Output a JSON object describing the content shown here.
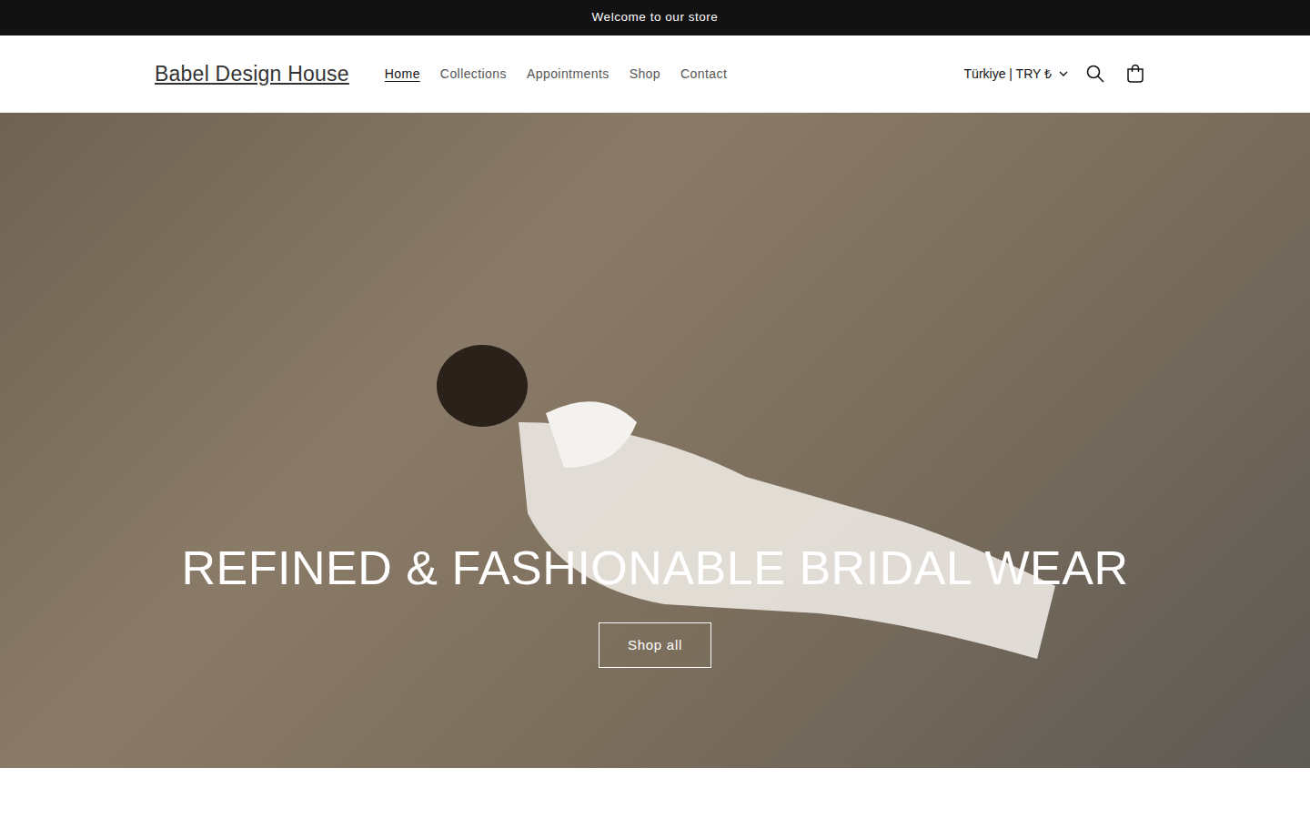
{
  "announcement": "Welcome to our store",
  "header": {
    "logo": "Babel Design House",
    "nav": [
      {
        "label": "Home",
        "selected": true
      },
      {
        "label": "Collections",
        "selected": false
      },
      {
        "label": "Appointments",
        "selected": false
      },
      {
        "label": "Shop",
        "selected": false
      },
      {
        "label": "Contact",
        "selected": false
      }
    ],
    "country": "Türkiye | TRY ₺"
  },
  "hero": {
    "title": "REFINED & FASHIONABLE BRIDAL WEAR",
    "button": "Shop all"
  }
}
